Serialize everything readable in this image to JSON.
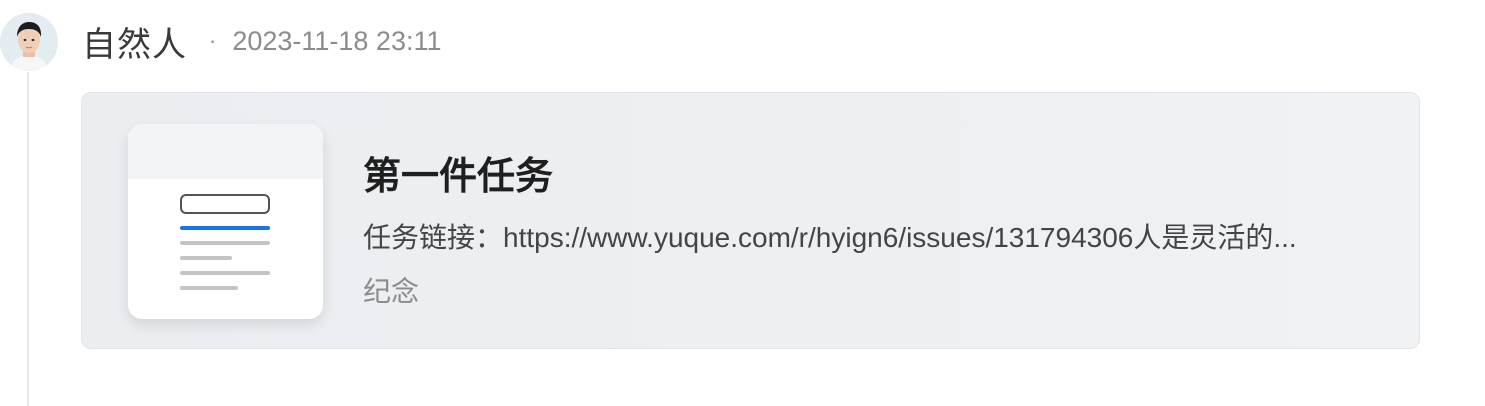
{
  "post": {
    "author": "自然人",
    "separator": "·",
    "timestamp": "2023-11-18 23:11"
  },
  "card": {
    "title": "第一件任务",
    "description": "任务链接：https://www.yuque.com/r/hyign6/issues/131794306人是灵活的...",
    "tag": "纪念",
    "thumbnail_icon": "document-icon"
  },
  "colors": {
    "accent": "#1a73e8",
    "card_background": "#edf0f3",
    "muted_text": "#8c8c8c"
  }
}
